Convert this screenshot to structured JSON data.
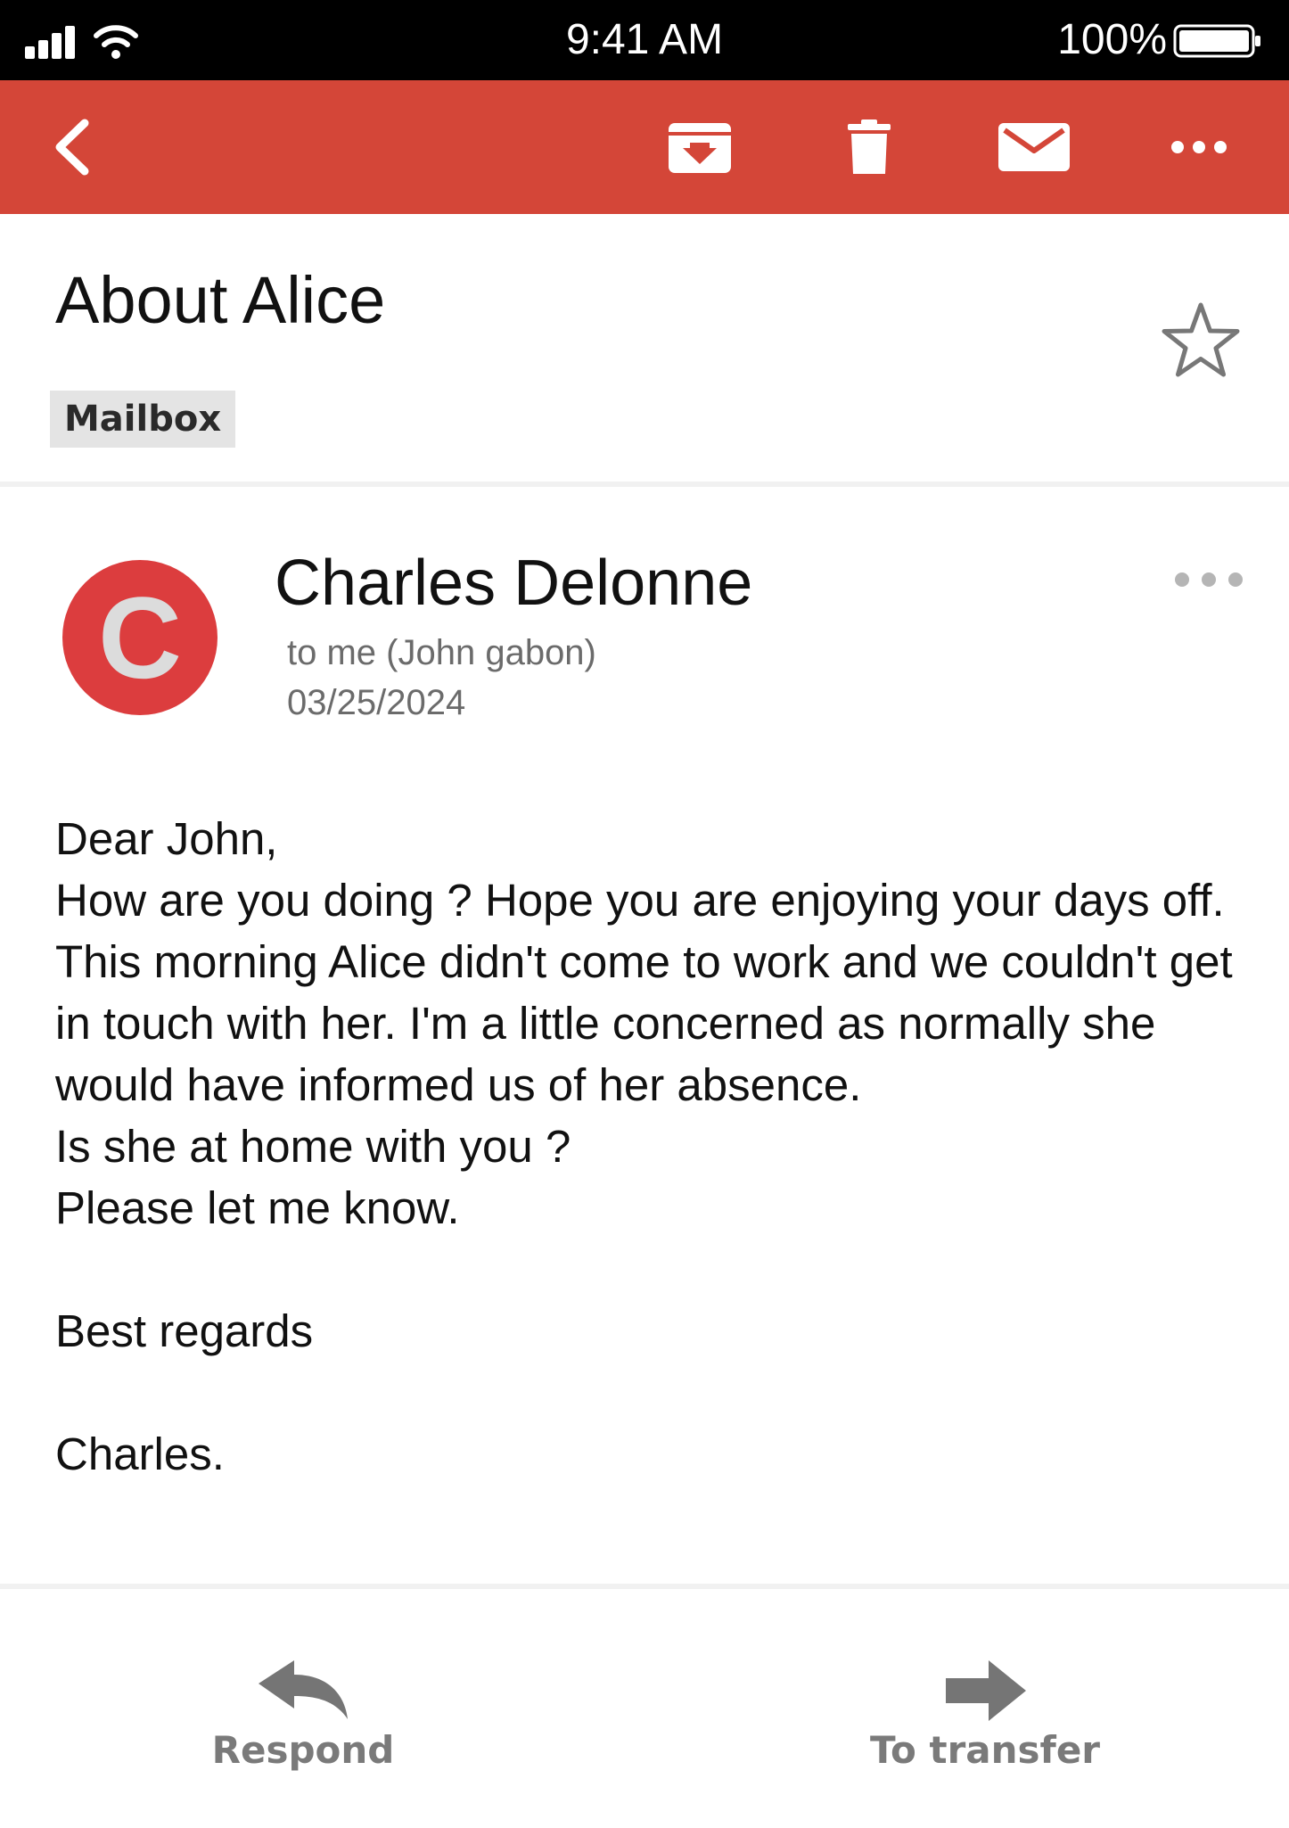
{
  "status_bar": {
    "time": "9:41 AM",
    "battery": "100%",
    "icons": [
      "signal-icon",
      "wifi-icon",
      "battery-icon"
    ]
  },
  "toolbar": {
    "background": "#d44638",
    "icons": [
      "back-icon",
      "archive-icon",
      "trash-icon",
      "mail-icon",
      "more-icon"
    ]
  },
  "email": {
    "subject": "About Alice",
    "label": "Mailbox",
    "starred": false,
    "sender": {
      "initial": "C",
      "name": "Charles Delonne",
      "avatar_color": "#dc3d3e"
    },
    "recipient": "to me (John gabon)",
    "date": "03/25/2024",
    "body": {
      "greeting": "Dear John,",
      "paragraph": "How are you doing ? Hope you are enjoying your days off. This morning Alice didn't come to work and we couldn't get in touch with her. I'm a little concerned as normally she would have informed us of her absence.",
      "question": "Is she at home with you ?",
      "request": "Please let me know.",
      "closing": "Best regards",
      "signature": "Charles."
    }
  },
  "actions": {
    "respond": "Respond",
    "transfer": "To transfer"
  }
}
